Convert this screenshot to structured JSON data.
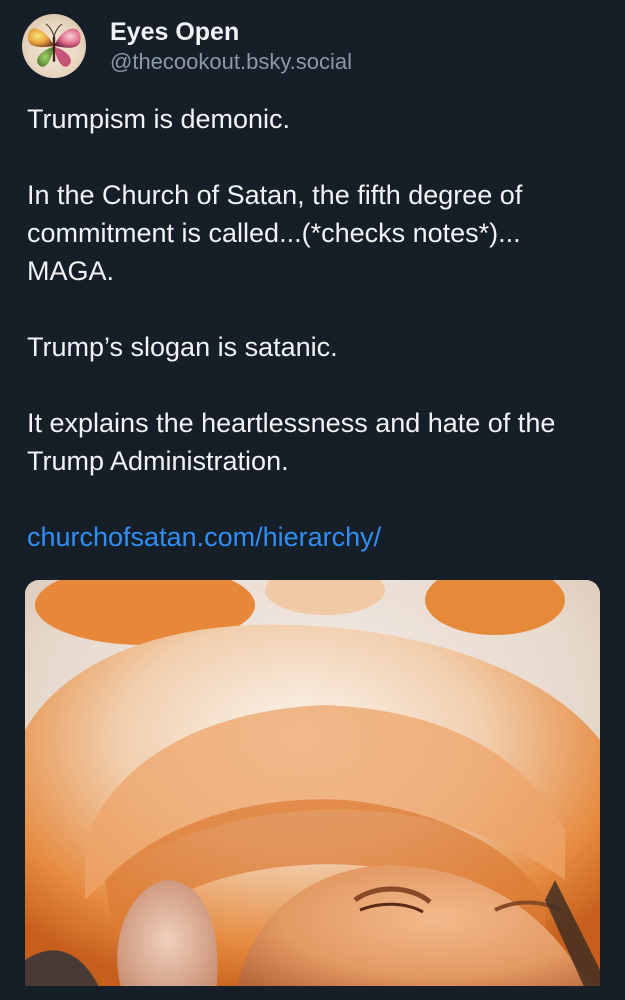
{
  "post": {
    "author": {
      "display_name": "Eyes Open",
      "handle": "@thecookout.bsky.social",
      "avatar_icon": "butterfly-icon"
    },
    "paragraphs": [
      "Trumpism is demonic.",
      "In the Church of Satan, the fifth degree of commitment is called...(*checks notes*)... MAGA.",
      "Trump’s slogan is satanic.",
      "It explains the heartlessness and hate of the Trump Administration."
    ],
    "link_text": "churchofsatan.com/hierarchy/"
  },
  "theme": {
    "background": "#161e27",
    "text": "#f1f3f5",
    "muted": "#8b98a8",
    "link": "#2f8ff7"
  }
}
